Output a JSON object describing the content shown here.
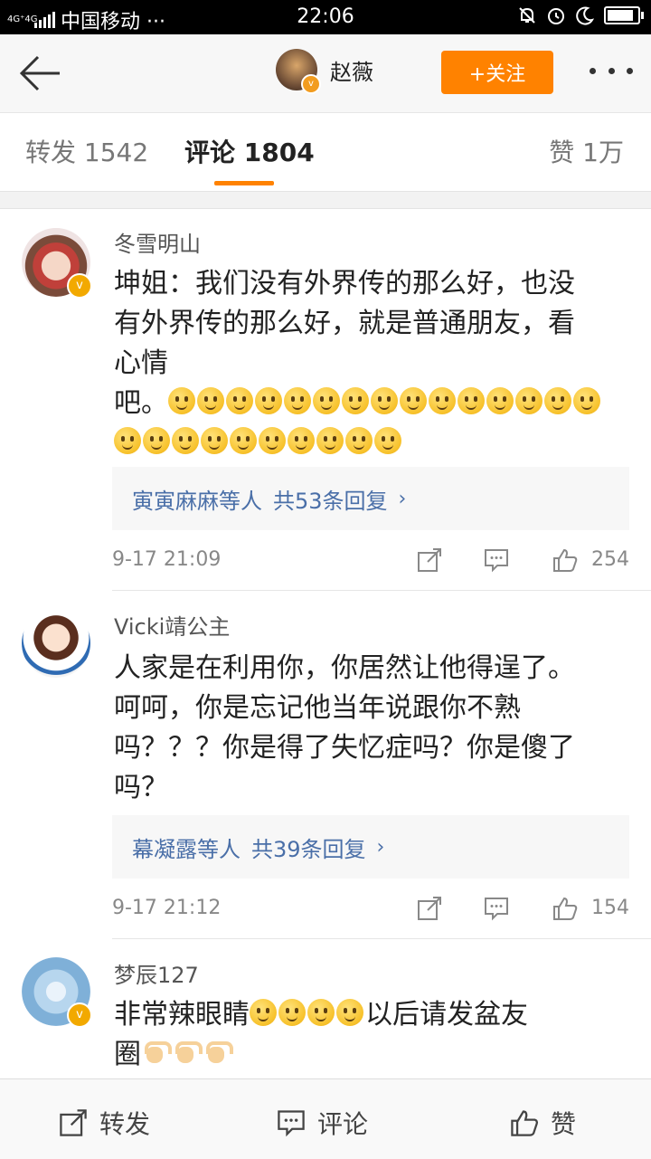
{
  "status_bar": {
    "network": "4G⁺4G",
    "carrier": "中国移动 ···",
    "time": "22:06"
  },
  "header": {
    "user_name": "赵薇",
    "follow_label": "+关注"
  },
  "tabs": {
    "repost": "转发 1542",
    "comment": "评论 1804",
    "like": "赞 1万"
  },
  "comments": [
    {
      "user": "冬雪明山",
      "text_lines": [
        "坤姐：我们没有外界传的那么好，也没",
        "有外界传的那么好，就是普通朋友，看",
        "心情",
        "吧。"
      ],
      "replies_names": "寅寅麻麻等人",
      "replies_count": "共53条回复",
      "time": "9-17 21:09",
      "likes": "254"
    },
    {
      "user": "Vicki靖公主",
      "text_lines": [
        "人家是在利用你，你居然让他得逞了。",
        "呵呵，你是忘记他当年说跟你不熟",
        "吗？？？你是得了失忆症吗？你是傻了",
        "吗？"
      ],
      "replies_names": "幕凝露等人",
      "replies_count": "共39条回复",
      "time": "9-17 21:12",
      "likes": "154"
    },
    {
      "user": "梦辰127",
      "text_line1_a": "非常辣眼睛",
      "text_line1_b": "以后请发盆友",
      "text_line2": "圈"
    }
  ],
  "bottom_bar": {
    "repost": "转发",
    "comment": "评论",
    "like": "赞"
  },
  "colors": {
    "accent": "#ff8200",
    "link": "#4a6fa8"
  }
}
